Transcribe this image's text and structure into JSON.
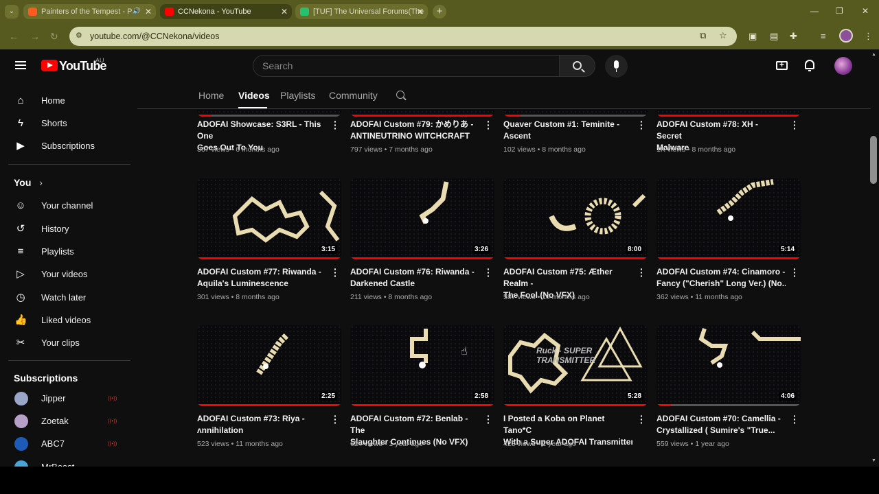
{
  "browser": {
    "tabs": [
      {
        "title": "Painters of the Tempest - P",
        "favicon_color": "#ff5a1f",
        "audio": true
      },
      {
        "title": "CCNekona - YouTube",
        "favicon_color": "#ff0000",
        "active": true
      },
      {
        "title": "[TUF] The Universal Forums(The",
        "favicon_color": "#25c16f"
      }
    ],
    "url": "youtube.com/@CCNekona/videos"
  },
  "masthead": {
    "logo_text": "YouTube",
    "country_code": "AU",
    "search_placeholder": "Search"
  },
  "sidebar": {
    "main": [
      {
        "label": "Home",
        "icon": "home-icon"
      },
      {
        "label": "Shorts",
        "icon": "shorts-icon"
      },
      {
        "label": "Subscriptions",
        "icon": "subscriptions-icon"
      }
    ],
    "you_header": "You",
    "you": [
      {
        "label": "Your channel",
        "icon": "channel-icon"
      },
      {
        "label": "History",
        "icon": "history-icon"
      },
      {
        "label": "Playlists",
        "icon": "playlists-icon"
      },
      {
        "label": "Your videos",
        "icon": "your-videos-icon"
      },
      {
        "label": "Watch later",
        "icon": "watch-later-icon"
      },
      {
        "label": "Liked videos",
        "icon": "liked-icon"
      },
      {
        "label": "Your clips",
        "icon": "clips-icon"
      }
    ],
    "subs_header": "Subscriptions",
    "subscriptions": [
      {
        "label": "Jipper",
        "color": "#9aa6c8",
        "live": true
      },
      {
        "label": "Zoetak",
        "color": "#b6a0c8",
        "live": true
      },
      {
        "label": "ABC7",
        "color": "#1e5bb8",
        "live": true
      },
      {
        "label": "MrBeast",
        "color": "#4aa3d8",
        "live": false
      }
    ]
  },
  "channel_tabs": [
    "Home",
    "Videos",
    "Playlists",
    "Community"
  ],
  "videos": [
    {
      "title_l1": "ADOFAI Showcase: S3RL - This One",
      "title_l2": "Goes Out To You",
      "meta": "367 views • 6 months ago",
      "progress": 0.1
    },
    {
      "title_l1": "ADOFAI Custom #79: かめりあ -",
      "title_l2": "ANTINEUTRINO WITCHCRAFT",
      "meta": "797 views • 7 months ago",
      "progress": 1.0
    },
    {
      "title_l1": "Quaver Custom #1: Teminite -",
      "title_l2": "Ascent",
      "meta": "102 views • 8 months ago",
      "progress": 0.12
    },
    {
      "title_l1": "ADOFAI Custom #78: XH - Secret",
      "title_l2": "Malware",
      "meta": "1K views • 8 months ago",
      "progress": 1.0
    },
    {
      "title_l1": "ADOFAI Custom #77: Riwanda -",
      "title_l2": "Aquila's Luminescence",
      "meta": "301 views • 8 months ago",
      "duration": "3:15",
      "progress": 1.0
    },
    {
      "title_l1": "ADOFAI Custom #76: Riwanda -",
      "title_l2": "Darkened Castle",
      "meta": "211 views • 8 months ago",
      "duration": "3:26",
      "progress": 1.0
    },
    {
      "title_l1": "ADOFAI Custom #75: Æther Realm -",
      "title_l2": "The Fool (No VFX)",
      "meta": "587 views • 10 months ago",
      "duration": "8:00",
      "progress": 1.0
    },
    {
      "title_l1": "ADOFAI Custom #74: Cinamoro -",
      "title_l2": "Fancy (\"Cherish\" Long Ver.) (No...",
      "meta": "362 views • 11 months ago",
      "duration": "5:14",
      "progress": 1.0
    },
    {
      "title_l1": "ADOFAI Custom #73: Riya -",
      "title_l2": "ᴧnnihilation",
      "meta": "523 views • 11 months ago",
      "duration": "2:25",
      "progress": 1.0
    },
    {
      "title_l1": "ADOFAI Custom #72: Benlab - The",
      "title_l2": "Slaughter Continues (No VFX)",
      "meta": "624 views • 1 year ago",
      "duration": "2:58",
      "progress": 1.0
    },
    {
      "title_l1": "I Posted a Koba on Planet Tano*C",
      "title_l2": "With a Super ADOFAI Transmitter...",
      "meta": "423 views • 1 year ago",
      "duration": "5:28",
      "progress": 1.0
    },
    {
      "title_l1": "ADOFAI Custom #70: Camellia -",
      "title_l2": "Crystallized ( Sumire's \"True...",
      "meta": "559 views • 1 year ago",
      "duration": "4:06",
      "progress": 0.1
    }
  ],
  "thumb_overlay_text": [
    "Ruck - SUPER",
    "TRANSMITTER"
  ]
}
